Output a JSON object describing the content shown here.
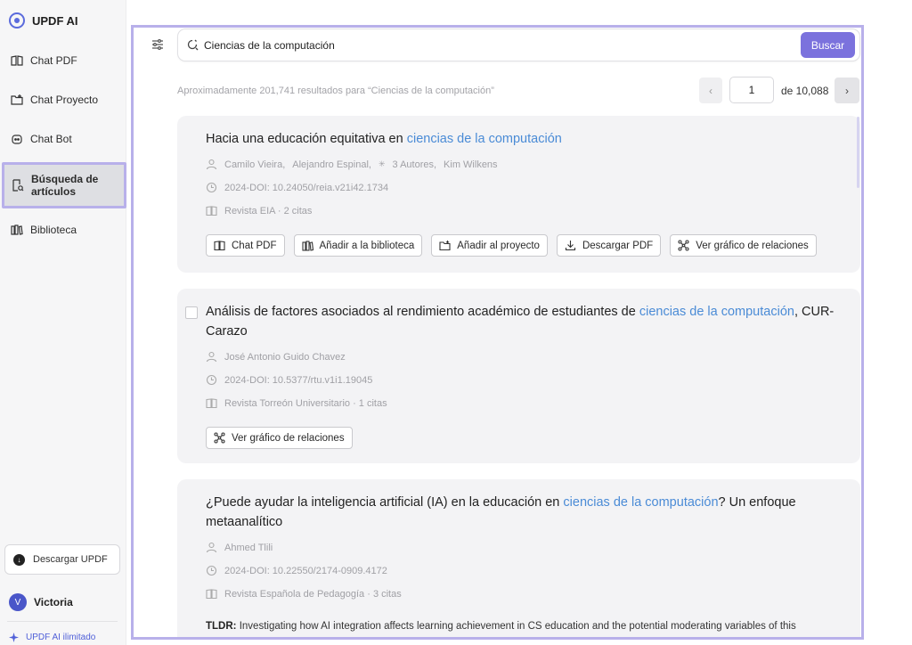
{
  "sidebar": {
    "brand": "UPDF AI",
    "items": [
      {
        "label": "Chat PDF",
        "icon": "book-open-icon"
      },
      {
        "label": "Chat Proyecto",
        "icon": "folder-plus-icon"
      },
      {
        "label": "Chat Bot",
        "icon": "bot-icon"
      },
      {
        "label_line1": "Búsqueda de",
        "label_line2": "artículos",
        "icon": "document-search-icon",
        "active": true
      },
      {
        "label": "Biblioteca",
        "icon": "library-icon"
      }
    ],
    "download_label": "Descargar UPDF",
    "user_initial": "V",
    "user_name": "Victoria",
    "unlimited_label": "UPDF AI ilimitado"
  },
  "search": {
    "value": "Ciencias de la computación",
    "button_label": "Buscar"
  },
  "results": {
    "count_text": "Aproximadamente 201,741 resultados para “Ciencias de la computación”",
    "page_value": "1",
    "page_total": "de 10,088"
  },
  "cards": [
    {
      "title_before": "Hacia una educación equitativa en ",
      "title_highlight": "ciencias de la computación",
      "title_after": "",
      "authors": [
        "Camilo Vieira,",
        "Alejandro Espinal,",
        "3 Autores,",
        "Kim Wilkens"
      ],
      "doi": "2024-DOI: 10.24050/reia.v21i42.1734",
      "journal": "Revista EIA · 2 citas",
      "actions": [
        {
          "label": "Chat PDF",
          "icon": "book-open-icon"
        },
        {
          "label": "Añadir a la biblioteca",
          "icon": "library-icon"
        },
        {
          "label": "Añadir al proyecto",
          "icon": "folder-plus-icon"
        },
        {
          "label": "Descargar PDF",
          "icon": "download-icon"
        },
        {
          "label": "Ver gráfico de relaciones",
          "icon": "graph-icon"
        }
      ]
    },
    {
      "title_before": "Análisis de factores asociados al rendimiento académico de estudiantes de ",
      "title_highlight": "ciencias de la computación",
      "title_after": ", CUR-Carazo",
      "author": "José Antonio Guido Chavez",
      "doi": "2024-DOI: 10.5377/rtu.v1i1.19045",
      "journal": "Revista Torreón Universitario · 1 citas",
      "actions": [
        {
          "label": "Ver gráfico de relaciones",
          "icon": "graph-icon"
        }
      ]
    },
    {
      "title_before": "¿Puede ayudar la inteligencia artificial (IA) en la educación en ",
      "title_highlight": "ciencias de la computación",
      "title_after": "? Un enfoque metaanalítico",
      "author": "Ahmed Tlili",
      "doi": "2024-DOI: 10.22550/2174-0909.4172",
      "journal": "Revista Española de Pedagogía · 3 citas",
      "tldr_label": "TLDR:",
      "tldr_text": "Investigating how AI integration affects learning achievement in CS education and the potential moderating variables of this"
    }
  ],
  "colors": {
    "accent": "#7b72dd",
    "highlight": "#4a8bd6",
    "frame": "#b8b0ea"
  }
}
